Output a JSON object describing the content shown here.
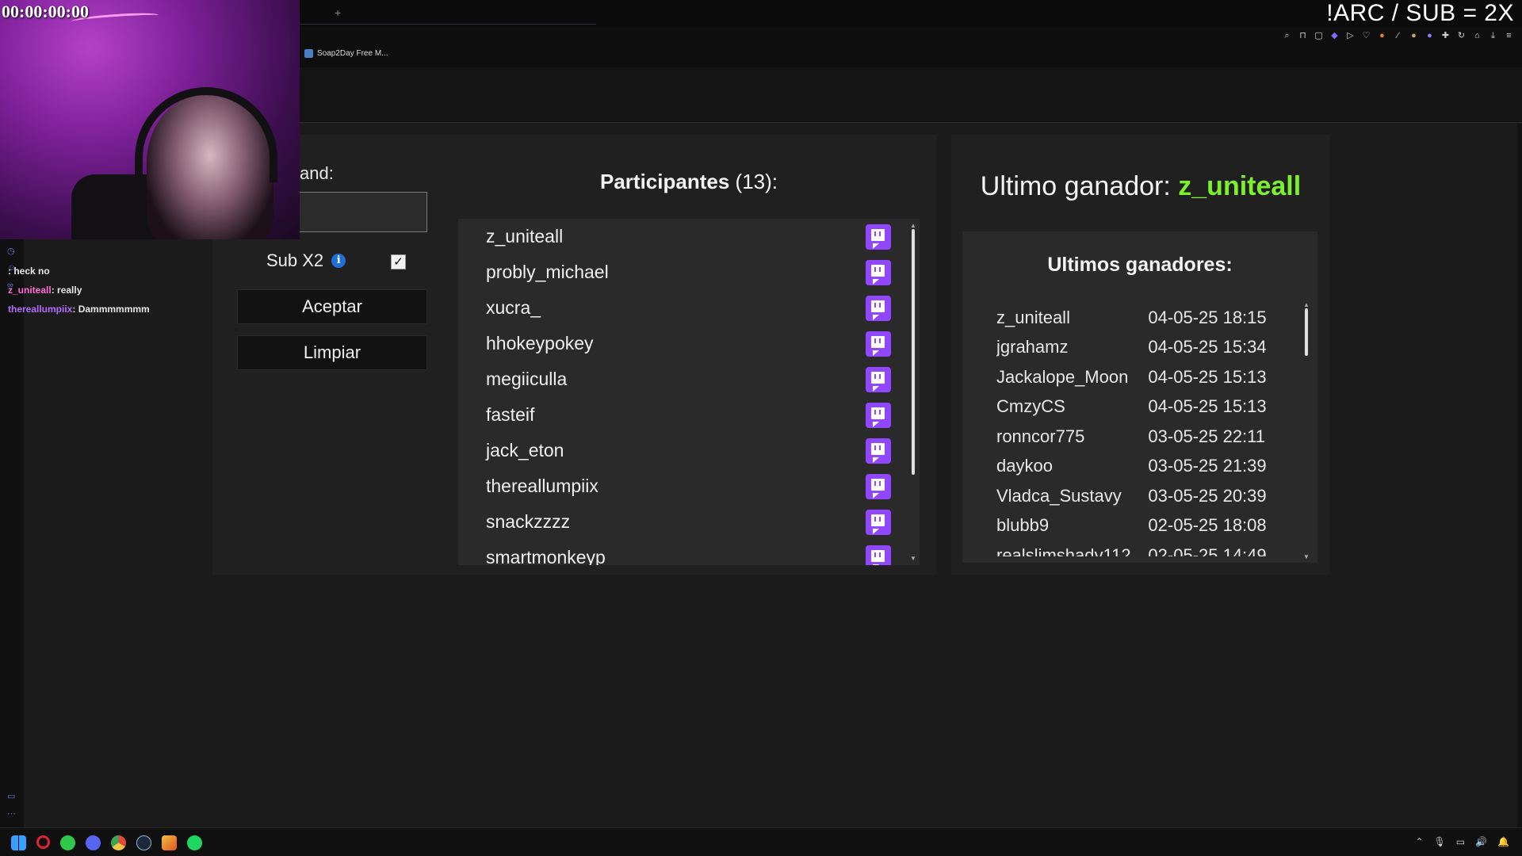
{
  "overlay": {
    "timer": "00:00:00:00",
    "command_banner": "!ARC / SUB = 2X"
  },
  "browser": {
    "new_tab": "+",
    "bookmark_label": "Soap2Day Free M..."
  },
  "chat": {
    "messages": [
      {
        "user": "",
        "text": ": heck no"
      },
      {
        "user": "z_uniteall",
        "text": ": really"
      },
      {
        "user": "thereallumpiix",
        "text": ": Dammmmmmm"
      }
    ]
  },
  "controls": {
    "command_label": "and:",
    "command_value": "",
    "subx2_label": "Sub X2",
    "subx2_checked": true,
    "accept_label": "Aceptar",
    "clear_label": "Limpiar"
  },
  "participants": {
    "title_bold": "Participantes",
    "count": "(13):",
    "items": [
      "z_uniteall",
      "probly_michael",
      "xucra_",
      "hhokeypokey",
      "megiiculla",
      "fasteif",
      "jack_eton",
      "thereallumpiix",
      "snackzzzz",
      "smartmonkeyp"
    ]
  },
  "winners": {
    "last_winner_label": "Ultimo ganador:",
    "last_winner_name": "z_uniteall",
    "history_title": "Ultimos ganadores:",
    "history": [
      {
        "name": "z_uniteall",
        "date": "04-05-25 18:15"
      },
      {
        "name": "jgrahamz",
        "date": "04-05-25 15:34"
      },
      {
        "name": "Jackalope_Moon",
        "date": "04-05-25 15:13"
      },
      {
        "name": "CmzyCS",
        "date": "04-05-25 15:13"
      },
      {
        "name": "ronncor775",
        "date": "03-05-25 22:11"
      },
      {
        "name": "daykoo",
        "date": "03-05-25 21:39"
      },
      {
        "name": "Vladca_Sustavy",
        "date": "03-05-25 20:39"
      },
      {
        "name": "blubb9",
        "date": "02-05-25 18:08"
      },
      {
        "name": "realslimshady112",
        "date": "02-05-25 14:49"
      }
    ]
  },
  "colors": {
    "accent_green": "#7cf02f",
    "twitch_purple": "#9146ff",
    "info_blue": "#1f6fd6"
  }
}
